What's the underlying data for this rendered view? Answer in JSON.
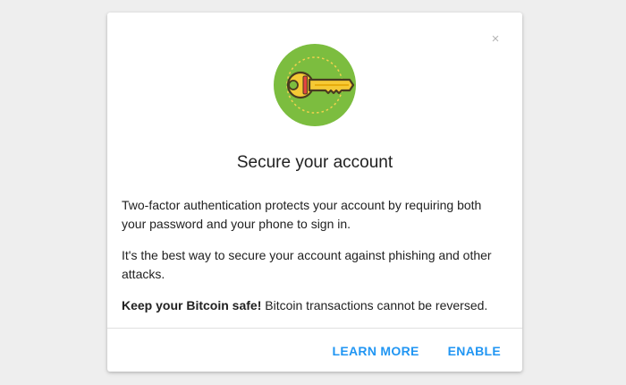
{
  "dialog": {
    "close_symbol": "×",
    "hero_icon": "key-icon",
    "title": "Secure your account",
    "paragraph1": "Two-factor authentication protects your account by requiring both your password and your phone to sign in.",
    "paragraph2": "It's the best way to secure your account against phishing and other attacks.",
    "paragraph3_bold": "Keep your Bitcoin safe!",
    "paragraph3_rest": " Bitcoin transactions cannot be reversed.",
    "actions": {
      "learn_more": "LEARN MORE",
      "enable": "ENABLE"
    }
  },
  "colors": {
    "accent": "#2196f3",
    "icon_bg": "#7cbd3f",
    "key": "#f6c935"
  }
}
